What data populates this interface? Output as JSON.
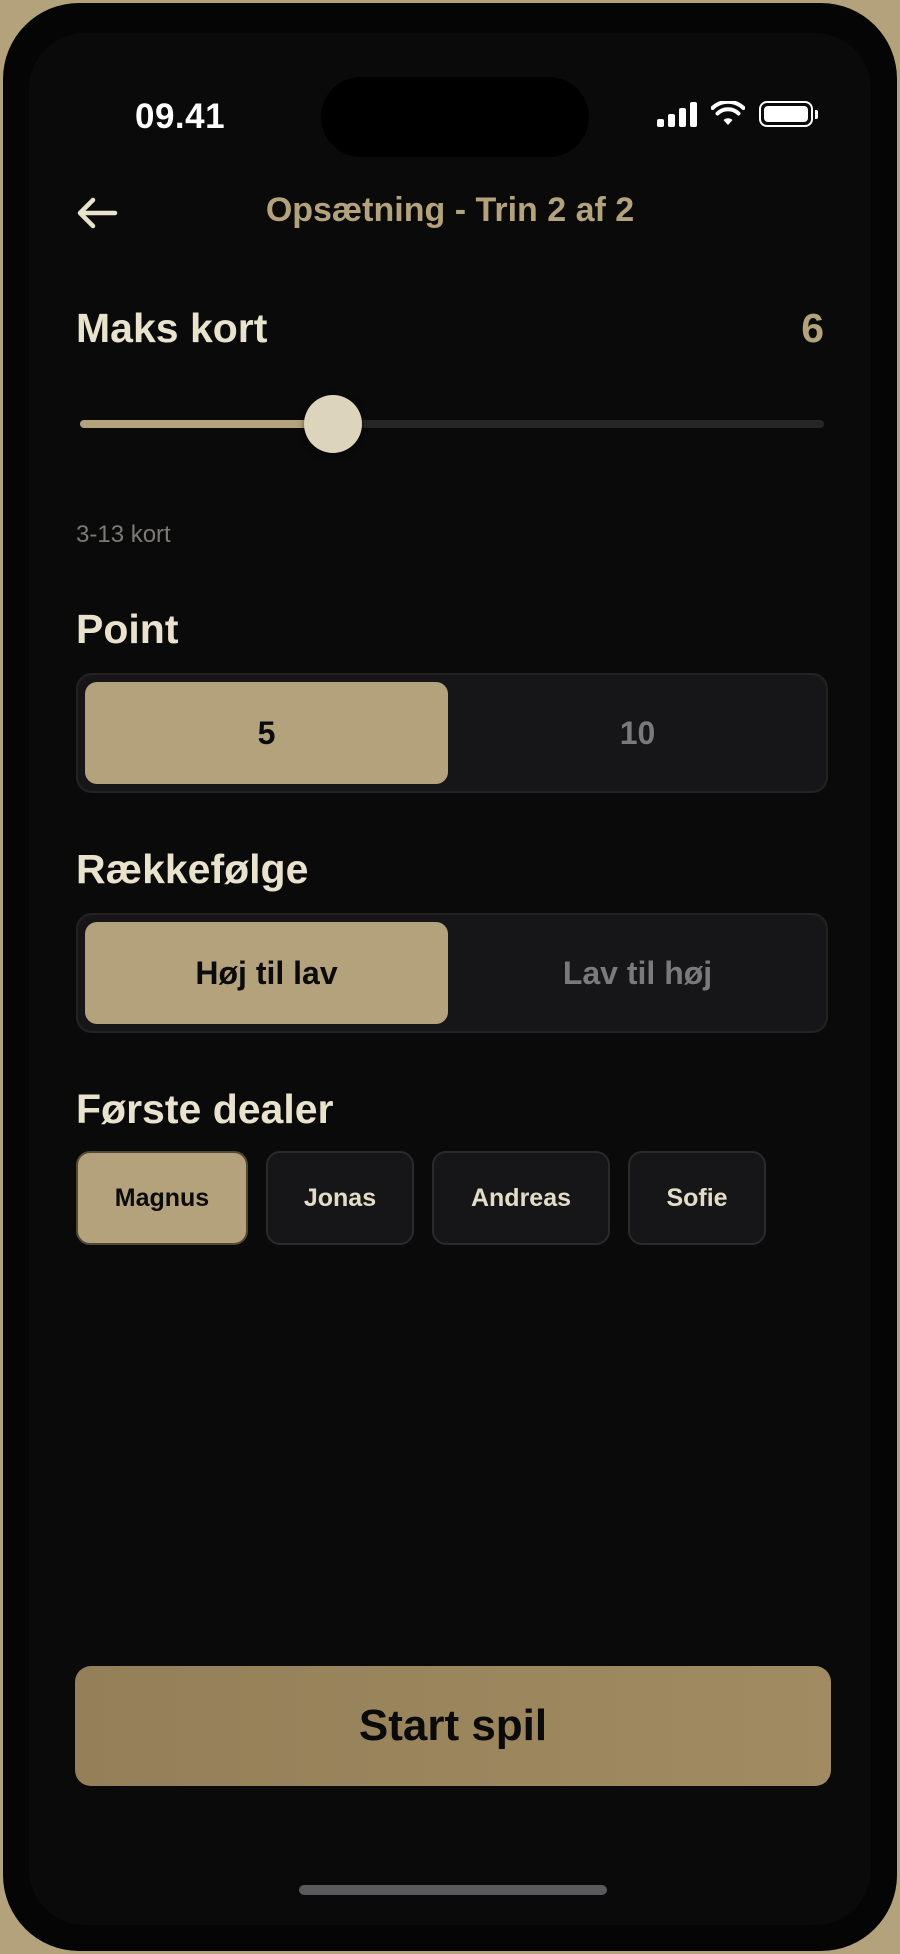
{
  "status_bar": {
    "time": "09.41"
  },
  "header": {
    "title": "Opsætning - Trin 2 af 2"
  },
  "max_cards": {
    "label": "Maks kort",
    "value": "6",
    "min": 3,
    "max": 13,
    "current": 6,
    "range_hint": "3-13 kort"
  },
  "points": {
    "label": "Point",
    "options": [
      "5",
      "10"
    ],
    "selected_index": 0
  },
  "order": {
    "label": "Rækkefølge",
    "options": [
      "Høj til lav",
      "Lav til høj"
    ],
    "selected_index": 0
  },
  "first_dealer": {
    "label": "Første dealer",
    "players": [
      "Magnus",
      "Jonas",
      "Andreas",
      "Sofie"
    ],
    "selected_index": 0
  },
  "start_button": {
    "label": "Start spil"
  },
  "colors": {
    "accent": "#b3a27c",
    "background": "#0a0a0b",
    "text": "#e9e2cd",
    "muted": "#7a7a7c"
  }
}
